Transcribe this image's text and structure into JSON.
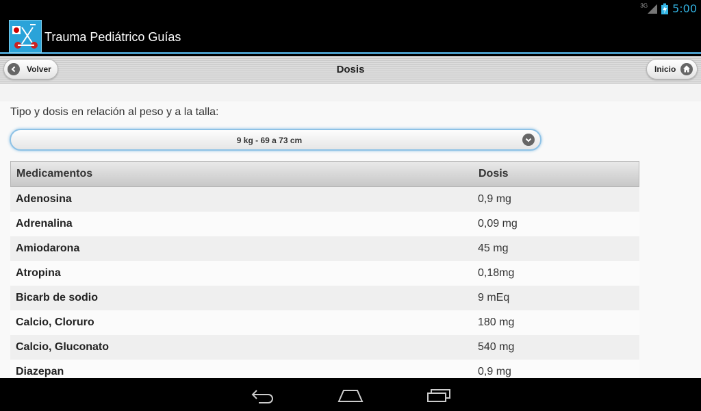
{
  "status": {
    "network": "3G",
    "time": "5:00"
  },
  "app": {
    "title": "Trauma Pediátrico Guías"
  },
  "header": {
    "back_label": "Volver",
    "title": "Dosis",
    "home_label": "Inicio"
  },
  "intro": "Tipo y dosis en relación al peso y a la talla:",
  "select": {
    "value": "9 kg - 69 a 73 cm"
  },
  "table": {
    "headers": [
      "Medicamentos",
      "Dosis"
    ],
    "rows": [
      [
        "Adenosina",
        "0,9 mg"
      ],
      [
        "Adrenalina",
        "0,09 mg"
      ],
      [
        "Amiodarona",
        "45 mg"
      ],
      [
        "Atropina",
        "0,18mg"
      ],
      [
        "Bicarb de sodio",
        "9 mEq"
      ],
      [
        "Calcio, Cloruro",
        "180 mg"
      ],
      [
        "Calcio, Gluconato",
        "540 mg"
      ],
      [
        "Diazepan",
        "0,9 mg"
      ]
    ]
  },
  "colors": {
    "accent": "#33b5e5",
    "select_border": "#8ec2e6"
  }
}
